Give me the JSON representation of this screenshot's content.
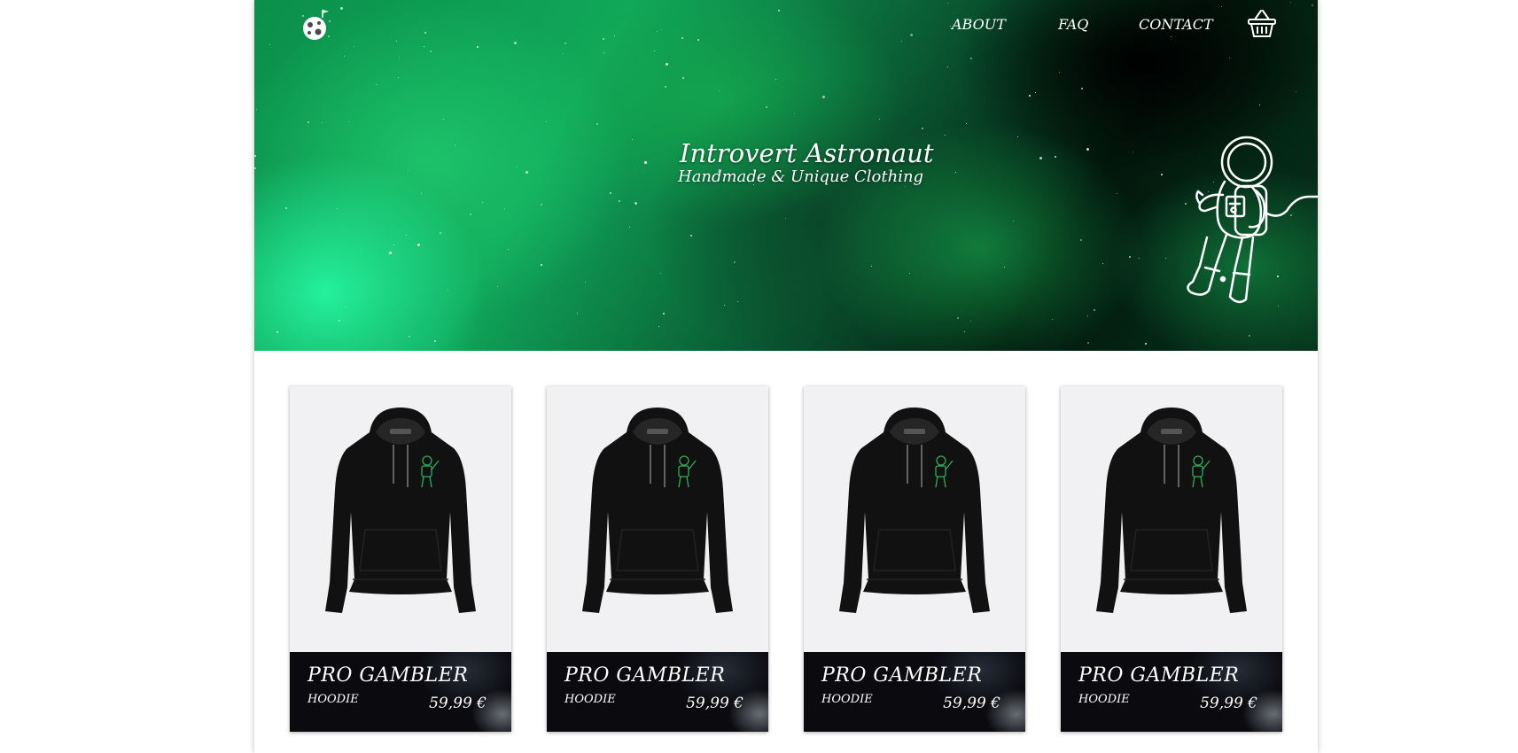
{
  "nav": {
    "about": "ABOUT",
    "faq": "FAQ",
    "contact": "CONTACT",
    "logo_icon": "moon-flag-icon",
    "cart_icon": "shopping-basket-icon"
  },
  "hero": {
    "title": "Introvert Astronaut",
    "subtitle": "Handmade & Unique Clothing",
    "illustration": "astronaut-outline",
    "colors": {
      "nebula": "#10a85a",
      "space": "#02170c",
      "text": "#ffffff"
    }
  },
  "products": [
    {
      "name": "PRO GAMBLER",
      "type": "HOODIE",
      "price": "59,99 €"
    },
    {
      "name": "PRO GAMBLER",
      "type": "HOODIE",
      "price": "59,99 €"
    },
    {
      "name": "PRO GAMBLER",
      "type": "HOODIE",
      "price": "59,99 €"
    },
    {
      "name": "PRO GAMBLER",
      "type": "HOODIE",
      "price": "59,99 €"
    }
  ],
  "colors": {
    "card_background": "#f1f1f3",
    "card_footer": "#0b0b0f",
    "hoodie": "#111111",
    "hoodie_logo": "#2fae5a"
  }
}
